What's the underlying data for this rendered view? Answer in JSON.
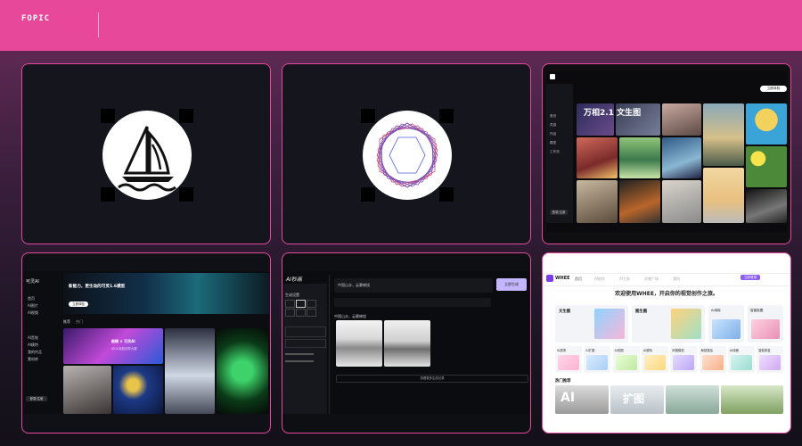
{
  "header": {
    "brand": "FOPIC"
  },
  "cards": {
    "card3": {
      "header_button": "立即体验",
      "side_items": [
        "首页",
        "灵感",
        "作品",
        "模型",
        "工作流",
        "排行",
        "AI视频"
      ],
      "side_footer": "登录/注册",
      "banner": "万相2.1 文生图"
    },
    "card4": {
      "logo": "可灵AI",
      "banner_title": "新能力，更生动的可灵1.6模型",
      "banner_button": "立即体验",
      "side_items": [
        "首页",
        "AI图片",
        "AI视频",
        "AI音效",
        "AI模特",
        "我的作品",
        "素材库"
      ],
      "tabs": [
        "推荐",
        "热门"
      ],
      "footer_button": "登录/注册",
      "feature_title": "剧情 × 可灵AI",
      "feature_sub": "AIGC高校创作大赛"
    },
    "card5": {
      "logo": "AI秒画",
      "prompt": "中国山水，云雾缭绕",
      "generate_button": "立即生成",
      "section_label": "生成设置",
      "results_label": "中国山水，云雾缭绕",
      "bottom_bar": "查看更多生成记录"
    },
    "card6": {
      "logo": "WHEE",
      "nav_items": [
        "首页",
        "AI创作",
        "AI工具",
        "灵感广场",
        "我的"
      ],
      "badge": "立即登录",
      "welcome": "欢迎使用WHEE，开启你的视觉创作之旅。",
      "feature_a": "文生图",
      "feature_b": "图生图",
      "feature_c": "AI消除",
      "feature_d": "智能抠图",
      "row_labels": [
        "AI超清",
        "AI扩图",
        "AI改图",
        "AI模特",
        "风格模型",
        "局部重绘",
        "AI线稿",
        "智能修复"
      ],
      "section": "热门推荐",
      "banner_left": "AI",
      "banner_mid": "扩图"
    }
  }
}
